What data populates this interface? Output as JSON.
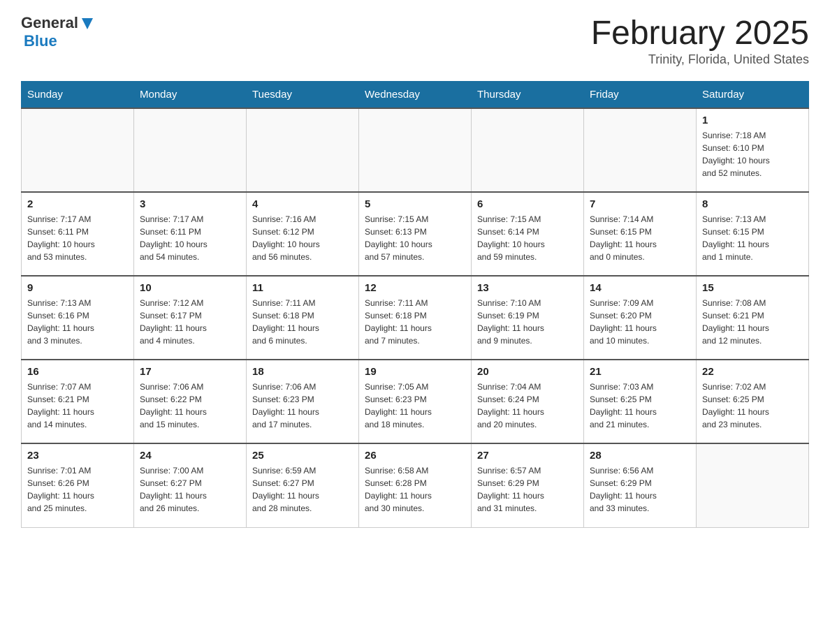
{
  "header": {
    "logo_general": "General",
    "logo_blue": "Blue",
    "title": "February 2025",
    "subtitle": "Trinity, Florida, United States"
  },
  "days_of_week": [
    "Sunday",
    "Monday",
    "Tuesday",
    "Wednesday",
    "Thursday",
    "Friday",
    "Saturday"
  ],
  "weeks": [
    [
      {
        "day": "",
        "info": ""
      },
      {
        "day": "",
        "info": ""
      },
      {
        "day": "",
        "info": ""
      },
      {
        "day": "",
        "info": ""
      },
      {
        "day": "",
        "info": ""
      },
      {
        "day": "",
        "info": ""
      },
      {
        "day": "1",
        "info": "Sunrise: 7:18 AM\nSunset: 6:10 PM\nDaylight: 10 hours\nand 52 minutes."
      }
    ],
    [
      {
        "day": "2",
        "info": "Sunrise: 7:17 AM\nSunset: 6:11 PM\nDaylight: 10 hours\nand 53 minutes."
      },
      {
        "day": "3",
        "info": "Sunrise: 7:17 AM\nSunset: 6:11 PM\nDaylight: 10 hours\nand 54 minutes."
      },
      {
        "day": "4",
        "info": "Sunrise: 7:16 AM\nSunset: 6:12 PM\nDaylight: 10 hours\nand 56 minutes."
      },
      {
        "day": "5",
        "info": "Sunrise: 7:15 AM\nSunset: 6:13 PM\nDaylight: 10 hours\nand 57 minutes."
      },
      {
        "day": "6",
        "info": "Sunrise: 7:15 AM\nSunset: 6:14 PM\nDaylight: 10 hours\nand 59 minutes."
      },
      {
        "day": "7",
        "info": "Sunrise: 7:14 AM\nSunset: 6:15 PM\nDaylight: 11 hours\nand 0 minutes."
      },
      {
        "day": "8",
        "info": "Sunrise: 7:13 AM\nSunset: 6:15 PM\nDaylight: 11 hours\nand 1 minute."
      }
    ],
    [
      {
        "day": "9",
        "info": "Sunrise: 7:13 AM\nSunset: 6:16 PM\nDaylight: 11 hours\nand 3 minutes."
      },
      {
        "day": "10",
        "info": "Sunrise: 7:12 AM\nSunset: 6:17 PM\nDaylight: 11 hours\nand 4 minutes."
      },
      {
        "day": "11",
        "info": "Sunrise: 7:11 AM\nSunset: 6:18 PM\nDaylight: 11 hours\nand 6 minutes."
      },
      {
        "day": "12",
        "info": "Sunrise: 7:11 AM\nSunset: 6:18 PM\nDaylight: 11 hours\nand 7 minutes."
      },
      {
        "day": "13",
        "info": "Sunrise: 7:10 AM\nSunset: 6:19 PM\nDaylight: 11 hours\nand 9 minutes."
      },
      {
        "day": "14",
        "info": "Sunrise: 7:09 AM\nSunset: 6:20 PM\nDaylight: 11 hours\nand 10 minutes."
      },
      {
        "day": "15",
        "info": "Sunrise: 7:08 AM\nSunset: 6:21 PM\nDaylight: 11 hours\nand 12 minutes."
      }
    ],
    [
      {
        "day": "16",
        "info": "Sunrise: 7:07 AM\nSunset: 6:21 PM\nDaylight: 11 hours\nand 14 minutes."
      },
      {
        "day": "17",
        "info": "Sunrise: 7:06 AM\nSunset: 6:22 PM\nDaylight: 11 hours\nand 15 minutes."
      },
      {
        "day": "18",
        "info": "Sunrise: 7:06 AM\nSunset: 6:23 PM\nDaylight: 11 hours\nand 17 minutes."
      },
      {
        "day": "19",
        "info": "Sunrise: 7:05 AM\nSunset: 6:23 PM\nDaylight: 11 hours\nand 18 minutes."
      },
      {
        "day": "20",
        "info": "Sunrise: 7:04 AM\nSunset: 6:24 PM\nDaylight: 11 hours\nand 20 minutes."
      },
      {
        "day": "21",
        "info": "Sunrise: 7:03 AM\nSunset: 6:25 PM\nDaylight: 11 hours\nand 21 minutes."
      },
      {
        "day": "22",
        "info": "Sunrise: 7:02 AM\nSunset: 6:25 PM\nDaylight: 11 hours\nand 23 minutes."
      }
    ],
    [
      {
        "day": "23",
        "info": "Sunrise: 7:01 AM\nSunset: 6:26 PM\nDaylight: 11 hours\nand 25 minutes."
      },
      {
        "day": "24",
        "info": "Sunrise: 7:00 AM\nSunset: 6:27 PM\nDaylight: 11 hours\nand 26 minutes."
      },
      {
        "day": "25",
        "info": "Sunrise: 6:59 AM\nSunset: 6:27 PM\nDaylight: 11 hours\nand 28 minutes."
      },
      {
        "day": "26",
        "info": "Sunrise: 6:58 AM\nSunset: 6:28 PM\nDaylight: 11 hours\nand 30 minutes."
      },
      {
        "day": "27",
        "info": "Sunrise: 6:57 AM\nSunset: 6:29 PM\nDaylight: 11 hours\nand 31 minutes."
      },
      {
        "day": "28",
        "info": "Sunrise: 6:56 AM\nSunset: 6:29 PM\nDaylight: 11 hours\nand 33 minutes."
      },
      {
        "day": "",
        "info": ""
      }
    ]
  ]
}
